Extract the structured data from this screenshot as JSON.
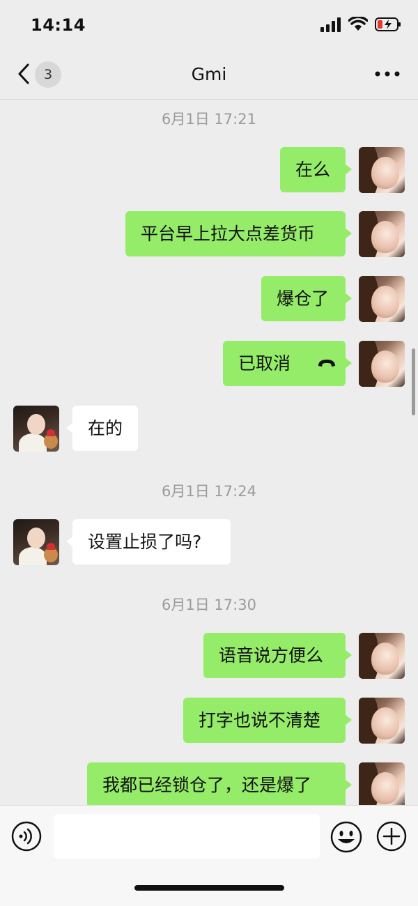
{
  "status_bar": {
    "time": "14:14"
  },
  "header": {
    "unread_count": "3",
    "title": "Gmi"
  },
  "messages": [
    {
      "type": "timestamp",
      "text": "6月1日 17:21"
    },
    {
      "type": "outgoing",
      "text": "在么"
    },
    {
      "type": "outgoing",
      "text": "平台早上拉大点差货币"
    },
    {
      "type": "outgoing",
      "text": "爆仓了"
    },
    {
      "type": "outgoing",
      "text": "已取消",
      "icon": "call-icon"
    },
    {
      "type": "incoming",
      "text": "在的"
    },
    {
      "type": "timestamp",
      "text": "6月1日 17:24"
    },
    {
      "type": "incoming",
      "text": "设置止损了吗?"
    },
    {
      "type": "timestamp",
      "text": "6月1日 17:30"
    },
    {
      "type": "outgoing",
      "text": "语音说方便么"
    },
    {
      "type": "outgoing",
      "text": "打字也说不清楚"
    },
    {
      "type": "outgoing",
      "text": "我都已经锁仓了，还是爆了"
    }
  ],
  "input_bar": {
    "text_value": ""
  }
}
